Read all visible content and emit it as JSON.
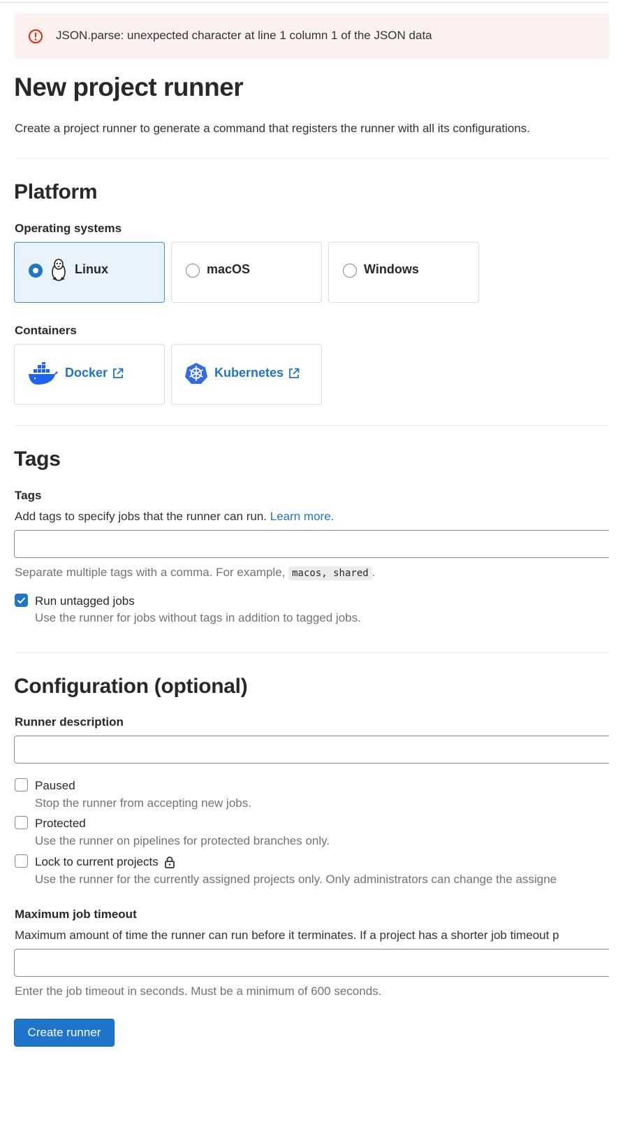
{
  "alert": {
    "message": "JSON.parse: unexpected character at line 1 column 1 of the JSON data",
    "icon": "error-icon"
  },
  "page": {
    "title": "New project runner",
    "description": "Create a project runner to generate a command that registers the runner with all its configurations."
  },
  "platform": {
    "heading": "Platform",
    "os_label": "Operating systems",
    "os_options": [
      {
        "name": "Linux",
        "selected": true,
        "icon": "tux-icon"
      },
      {
        "name": "macOS",
        "selected": false
      },
      {
        "name": "Windows",
        "selected": false
      }
    ],
    "containers_label": "Containers",
    "containers": [
      {
        "name": "Docker",
        "icon": "docker-icon"
      },
      {
        "name": "Kubernetes",
        "icon": "kubernetes-icon"
      }
    ]
  },
  "tags": {
    "heading": "Tags",
    "label": "Tags",
    "description": "Add tags to specify jobs that the runner can run.",
    "learn_more": "Learn more.",
    "input_value": "",
    "help_prefix": "Separate multiple tags with a comma. For example,",
    "help_code": "macos, shared",
    "help_suffix": ".",
    "run_untagged": {
      "label": "Run untagged jobs",
      "help": "Use the runner for jobs without tags in addition to tagged jobs.",
      "checked": true
    }
  },
  "configuration": {
    "heading": "Configuration (optional)",
    "runner_description_label": "Runner description",
    "runner_description_value": "",
    "options": [
      {
        "label": "Paused",
        "help": "Stop the runner from accepting new jobs.",
        "checked": false
      },
      {
        "label": "Protected",
        "help": "Use the runner on pipelines for protected branches only.",
        "checked": false
      },
      {
        "label": "Lock to current projects",
        "help": "Use the runner for the currently assigned projects only. Only administrators can change the assigne",
        "checked": false,
        "icon": "lock-icon"
      }
    ],
    "timeout_label": "Maximum job timeout",
    "timeout_description": "Maximum amount of time the runner can run before it terminates. If a project has a shorter job timeout p",
    "timeout_value": "",
    "timeout_help": "Enter the job timeout in seconds. Must be a minimum of 600 seconds."
  },
  "submit": {
    "label": "Create runner"
  },
  "colors": {
    "primary": "#1f75cb",
    "alert_bg": "#fcf1ef",
    "danger": "#dd2b0e",
    "selected_bg": "#e9f3fc"
  }
}
